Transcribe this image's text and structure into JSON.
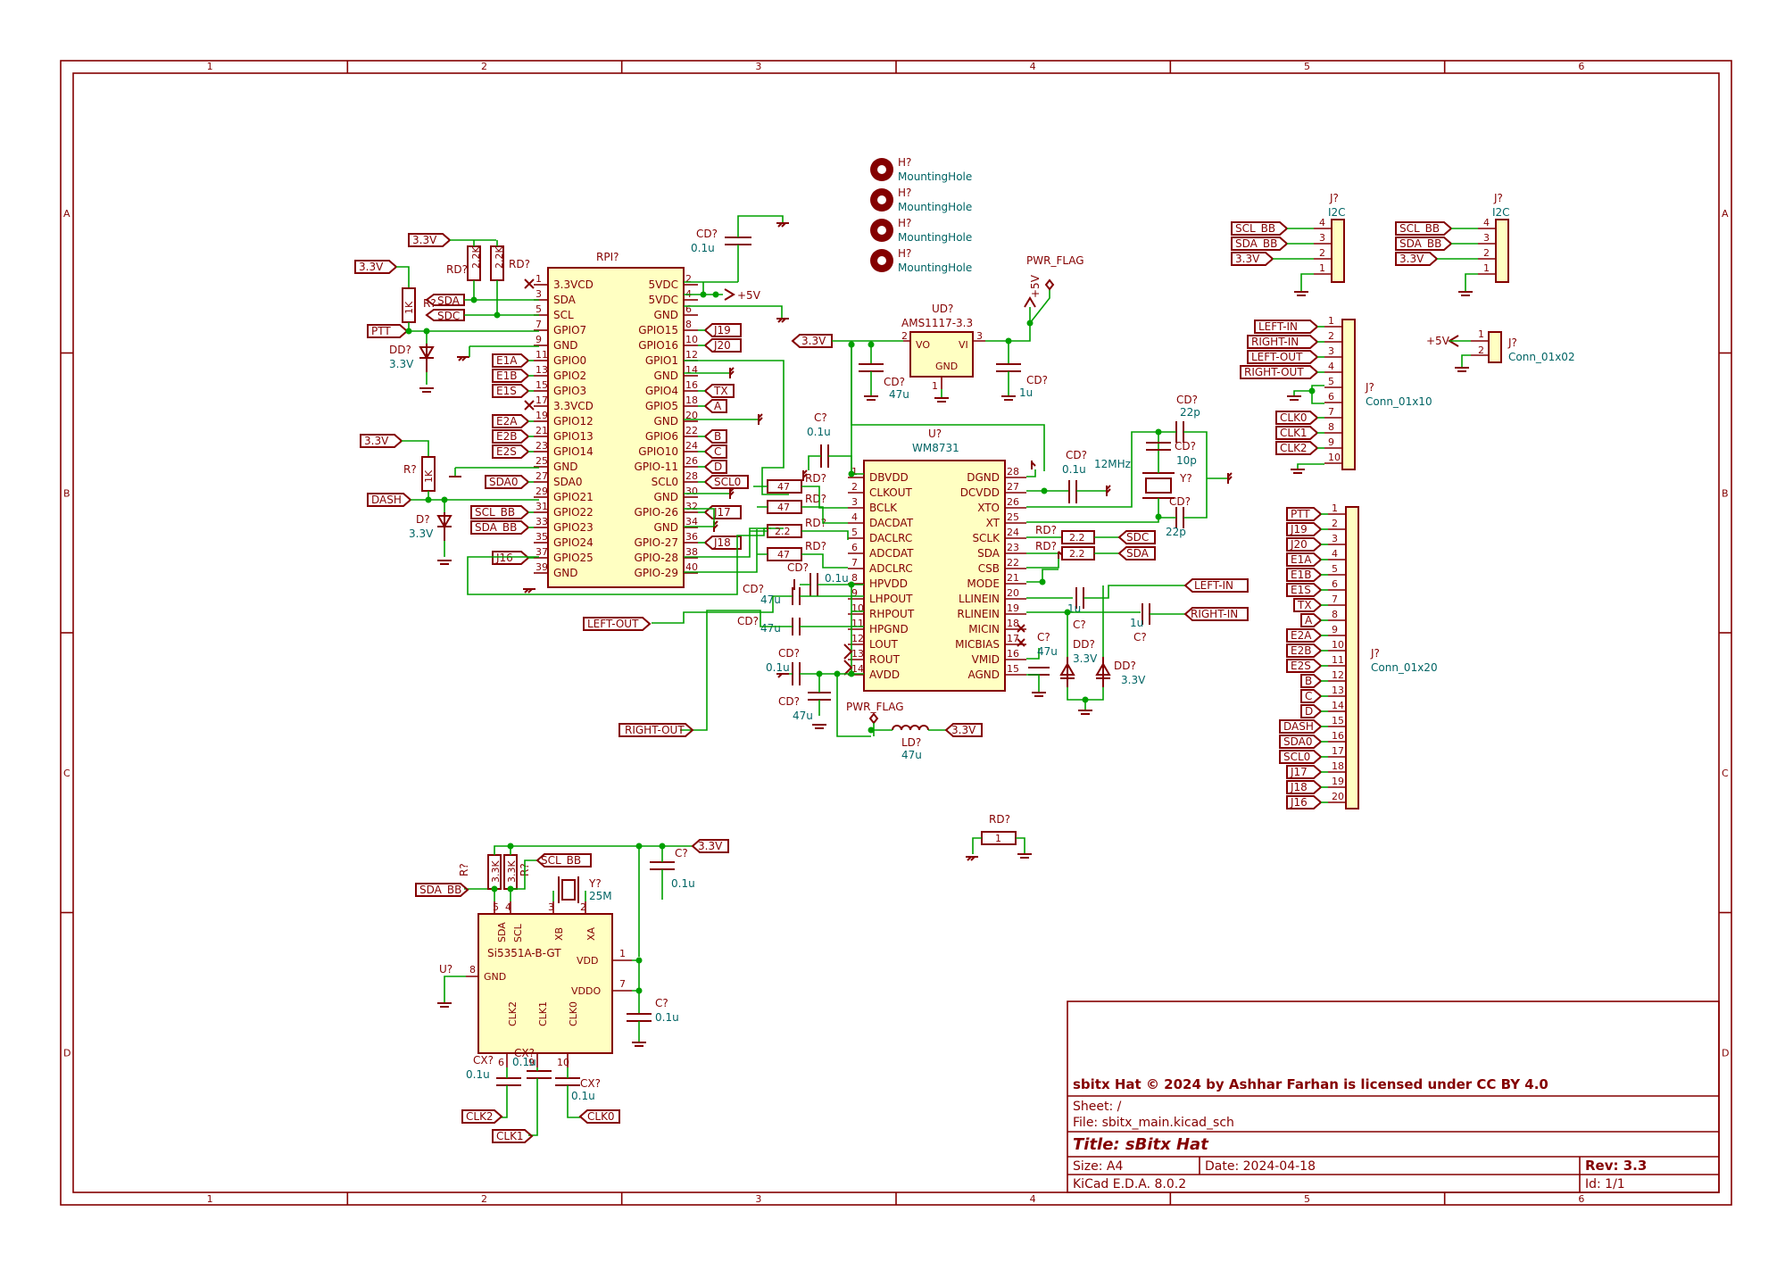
{
  "title_block": {
    "license": "sbitx Hat © 2024 by Ashhar Farhan is licensed under CC BY 4.0",
    "sheet": "Sheet: /",
    "file": "File: sbitx_main.kicad_sch",
    "title": "Title: sBitx Hat",
    "size": "Size: A4",
    "date": "Date: 2024-04-18",
    "rev": "Rev: 3.3",
    "tool": "KiCad E.D.A. 8.0.2",
    "id": "Id: 1/1"
  },
  "border": {
    "columns": [
      "1",
      "2",
      "3",
      "4",
      "5",
      "6"
    ],
    "rows": [
      "A",
      "B",
      "C",
      "D"
    ]
  },
  "mounting_holes": [
    {
      "ref": "H?",
      "value": "MountingHole"
    },
    {
      "ref": "H?",
      "value": "MountingHole"
    },
    {
      "ref": "H?",
      "value": "MountingHole"
    },
    {
      "ref": "H?",
      "value": "MountingHole"
    }
  ],
  "rpi": {
    "ref": "RPI?",
    "left_pins": [
      {
        "num": "1",
        "name": "3.3VCD"
      },
      {
        "num": "3",
        "name": "SDA"
      },
      {
        "num": "5",
        "name": "SCL"
      },
      {
        "num": "7",
        "name": "GPIO7"
      },
      {
        "num": "9",
        "name": "GND"
      },
      {
        "num": "11",
        "name": "GPIO0"
      },
      {
        "num": "13",
        "name": "GPIO2"
      },
      {
        "num": "15",
        "name": "GPIO3"
      },
      {
        "num": "17",
        "name": "3.3VCD"
      },
      {
        "num": "19",
        "name": "GPIO12"
      },
      {
        "num": "21",
        "name": "GPIO13"
      },
      {
        "num": "23",
        "name": "GPIO14"
      },
      {
        "num": "25",
        "name": "GND"
      },
      {
        "num": "27",
        "name": "SDA0"
      },
      {
        "num": "29",
        "name": "GPIO21"
      },
      {
        "num": "31",
        "name": "GPIO22"
      },
      {
        "num": "33",
        "name": "GPIO23"
      },
      {
        "num": "35",
        "name": "GPIO24"
      },
      {
        "num": "37",
        "name": "GPIO25"
      },
      {
        "num": "39",
        "name": "GND"
      }
    ],
    "right_pins": [
      {
        "num": "2",
        "name": "5VDC"
      },
      {
        "num": "4",
        "name": "5VDC"
      },
      {
        "num": "6",
        "name": "GND"
      },
      {
        "num": "8",
        "name": "GPIO15"
      },
      {
        "num": "10",
        "name": "GPIO16"
      },
      {
        "num": "12",
        "name": "GPIO1"
      },
      {
        "num": "14",
        "name": "GND"
      },
      {
        "num": "16",
        "name": "GPIO4"
      },
      {
        "num": "18",
        "name": "GPIO5"
      },
      {
        "num": "20",
        "name": "GND"
      },
      {
        "num": "22",
        "name": "GPIO6"
      },
      {
        "num": "24",
        "name": "GPIO10"
      },
      {
        "num": "26",
        "name": "GPIO-11"
      },
      {
        "num": "28",
        "name": "SCL0"
      },
      {
        "num": "30",
        "name": "GND"
      },
      {
        "num": "32",
        "name": "GPIO-26"
      },
      {
        "num": "34",
        "name": "GND"
      },
      {
        "num": "36",
        "name": "GPIO-27"
      },
      {
        "num": "38",
        "name": "GPIO-28"
      },
      {
        "num": "40",
        "name": "GPIO-29"
      }
    ],
    "left_labels": [
      "SDA",
      "SDC",
      "PTT",
      "E1A",
      "E1B",
      "E1S",
      "E2A",
      "E2B",
      "E2S",
      "SDA0",
      "DASH",
      "SCL_BB",
      "SDA_BB",
      "J16"
    ],
    "right_labels": [
      "J19",
      "J20",
      "TX",
      "A",
      "B",
      "C",
      "D",
      "SCL0",
      "J17",
      "J18"
    ]
  },
  "wm8731": {
    "ref": "U?",
    "value": "WM8731",
    "left_pins": [
      {
        "num": "1",
        "name": "DBVDD"
      },
      {
        "num": "2",
        "name": "CLKOUT"
      },
      {
        "num": "3",
        "name": "BCLK"
      },
      {
        "num": "4",
        "name": "DACDAT"
      },
      {
        "num": "5",
        "name": "DACLRC"
      },
      {
        "num": "6",
        "name": "ADCDAT"
      },
      {
        "num": "7",
        "name": "ADCLRC"
      },
      {
        "num": "8",
        "name": "HPVDD"
      },
      {
        "num": "9",
        "name": "LHPOUT"
      },
      {
        "num": "10",
        "name": "RHPOUT"
      },
      {
        "num": "11",
        "name": "HPGND"
      },
      {
        "num": "12",
        "name": "LOUT"
      },
      {
        "num": "13",
        "name": "ROUT"
      },
      {
        "num": "14",
        "name": "AVDD"
      }
    ],
    "right_pins": [
      {
        "num": "28",
        "name": "DGND"
      },
      {
        "num": "27",
        "name": "DCVDD"
      },
      {
        "num": "26",
        "name": "XTO"
      },
      {
        "num": "25",
        "name": "XT"
      },
      {
        "num": "24",
        "name": "SCLK"
      },
      {
        "num": "23",
        "name": "SDA"
      },
      {
        "num": "22",
        "name": "CSB"
      },
      {
        "num": "21",
        "name": "MODE"
      },
      {
        "num": "20",
        "name": "LLINEIN"
      },
      {
        "num": "19",
        "name": "RLINEIN"
      },
      {
        "num": "18",
        "name": "MICIN"
      },
      {
        "num": "17",
        "name": "MICBIAS"
      },
      {
        "num": "16",
        "name": "VMID"
      },
      {
        "num": "15",
        "name": "AGND"
      }
    ]
  },
  "si5351": {
    "ref": "U?",
    "value": "Si5351A-B-GT",
    "pins": {
      "sda": {
        "num": "5",
        "name": "SDA"
      },
      "scl": {
        "num": "4",
        "name": "SCL"
      },
      "xb": {
        "num": "3",
        "name": "XB"
      },
      "xa": {
        "num": "2",
        "name": "XA"
      },
      "vdd": {
        "num": "1",
        "name": "VDD"
      },
      "vddo": {
        "num": "7",
        "name": "VDDO"
      },
      "gnd": {
        "num": "8",
        "name": "GND"
      },
      "clk2": {
        "num": "6",
        "name": "CLK2"
      },
      "clk1": {
        "num": "9",
        "name": "CLK1"
      },
      "clk0": {
        "num": "10",
        "name": "CLK0"
      }
    },
    "crystal": {
      "ref": "Y?",
      "value": "25M"
    }
  },
  "regulator": {
    "ref": "UD?",
    "value": "AMS1117-3.3",
    "pins": {
      "vo": "VO",
      "vi": "VI",
      "gnd": "GND",
      "vo_num": "2",
      "vi_num": "3",
      "gnd_num": "1"
    }
  },
  "components": {
    "r_2k2_a": "2.2K",
    "r_2k2_b": "2.2K",
    "r_1k_a": "1K",
    "r_1k_b": "1K",
    "r_3k3_a": "3.3K",
    "r_3k3_b": "3.3K",
    "r_47_a": "47",
    "r_47_b": "47",
    "r_2_2_a": "2.2",
    "r_47_c": "47",
    "r_2_2_sda": "2.2",
    "r_2_2_sdc": "2.2",
    "r_1": "1",
    "ref_r": "R?",
    "ref_rd": "RD?",
    "ref_c": "C?",
    "ref_cd": "CD?",
    "ref_cx": "CX?",
    "ref_d": "D?",
    "ref_dd": "DD?",
    "ref_ld": "LD?",
    "ref_y": "Y?",
    "v_0_1u": "0.1u",
    "v_47u": "47u",
    "v_1u": "1u",
    "v_22p": "22p",
    "v_10p": "10p",
    "v_12mhz": "12MHz",
    "v_3_3v": "3.3V"
  },
  "nets": {
    "v33": "3.3V",
    "v5": "+5V",
    "pwr_flag": "PWR_FLAG",
    "left_out": "LEFT-OUT",
    "right_out": "RIGHT-OUT",
    "left_in": "LEFT-IN",
    "right_in": "RIGHT-IN",
    "sdc": "SDC",
    "sda": "SDA",
    "scl_bb": "SCL_BB",
    "sda_bb": "SDA_BB",
    "clk0": "CLK0",
    "clk1": "CLK1",
    "clk2": "CLK2"
  },
  "i2c_connectors": [
    {
      "ref": "J?",
      "value": "I2C",
      "labels": [
        "SCL_BB",
        "SDA_BB",
        "3.3V"
      ],
      "pins": [
        "4",
        "3",
        "2",
        "1"
      ]
    },
    {
      "ref": "J?",
      "value": "I2C",
      "labels": [
        "SCL_BB",
        "SDA_BB",
        "3.3V"
      ],
      "pins": [
        "4",
        "3",
        "2",
        "1"
      ]
    }
  ],
  "conn_01x02": {
    "ref": "J?",
    "value": "Conn_01x02",
    "label": "+5V",
    "pins": [
      "1",
      "2"
    ]
  },
  "conn_01x10": {
    "ref": "J?",
    "value": "Conn_01x10",
    "labels": [
      "LEFT-IN",
      "RIGHT-IN",
      "LEFT-OUT",
      "RIGHT-OUT",
      "",
      "",
      "CLK0",
      "CLK1",
      "CLK2",
      ""
    ],
    "pins": [
      "1",
      "2",
      "3",
      "4",
      "5",
      "6",
      "7",
      "8",
      "9",
      "10"
    ]
  },
  "conn_01x20": {
    "ref": "J?",
    "value": "Conn_01x20",
    "labels": [
      "PTT",
      "J19",
      "J20",
      "E1A",
      "E1B",
      "E1S",
      "TX",
      "A",
      "E2A",
      "E2B",
      "E2S",
      "B",
      "C",
      "D",
      "DASH",
      "SDA0",
      "SCL0",
      "J17",
      "J18",
      "J16"
    ],
    "pins": [
      "1",
      "2",
      "3",
      "4",
      "5",
      "6",
      "7",
      "8",
      "9",
      "10",
      "11",
      "12",
      "13",
      "14",
      "15",
      "16",
      "17",
      "18",
      "19",
      "20"
    ]
  },
  "colors": {
    "symbol": "#840000",
    "body_fill": "#ffffc2",
    "wire": "#00a000",
    "ref_text": "#006464",
    "background": "#ffffff"
  }
}
